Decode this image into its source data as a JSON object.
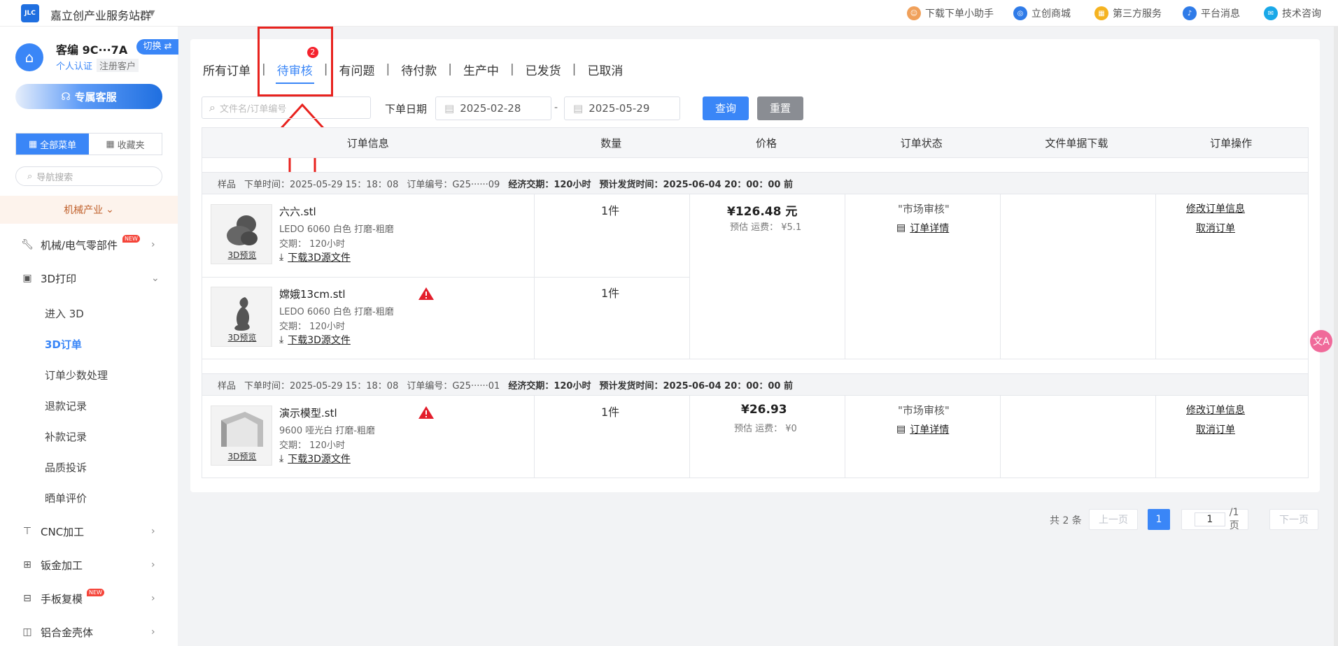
{
  "topbar": {
    "logo_text": "JLC",
    "site_title": "嘉立创产业服务站群",
    "links": [
      {
        "label": "下载下单小助手",
        "icon": "assistant-icon",
        "color": "#f0a05a"
      },
      {
        "label": "立创商城",
        "icon": "mall-icon",
        "color": "#2f7be8"
      },
      {
        "label": "第三方服务",
        "icon": "grid-icon",
        "color": "#f5b320"
      },
      {
        "label": "平台消息",
        "icon": "bell-icon",
        "color": "#2f7be8"
      },
      {
        "label": "技术咨询",
        "icon": "chat-icon",
        "color": "#19a8e8"
      }
    ]
  },
  "sidebar": {
    "customer_id": "客编 9C···7A",
    "switch_label": "切换 ⇄",
    "tag_verify": "个人认证",
    "tag_registered": "注册客户",
    "service_btn": "专属客服",
    "tab_all": "全部菜单",
    "tab_fav": "收藏夹",
    "search_placeholder": "导航搜索",
    "industry": "机械产业",
    "items": [
      {
        "label": "机械/电气零部件",
        "icon": "wrench-icon",
        "badge": "NEW"
      },
      {
        "label": "3D打印",
        "icon": "3d-print-icon"
      },
      {
        "label": "CNC加工",
        "icon": "cnc-icon"
      },
      {
        "label": "钣金加工",
        "icon": "sheet-metal-icon"
      },
      {
        "label": "手板复模",
        "icon": "mold-icon",
        "badge": "NEW"
      },
      {
        "label": "铝合金壳体",
        "icon": "enclosure-icon"
      }
    ],
    "sub_items": [
      "进入 3D",
      "3D订单",
      "订单少数处理",
      "退款记录",
      "补款记录",
      "品质投诉",
      "晒单评价"
    ]
  },
  "tabs": [
    {
      "label": "所有订单"
    },
    {
      "label": "待审核",
      "badge": "2"
    },
    {
      "label": "有问题"
    },
    {
      "label": "待付款"
    },
    {
      "label": "生产中"
    },
    {
      "label": "已发货"
    },
    {
      "label": "已取消"
    }
  ],
  "filter": {
    "search_placeholder": "文件名/订单编号",
    "date_label": "下单日期",
    "date_from": "2025-02-28",
    "date_to": "2025-05-29",
    "query_btn": "查询",
    "reset_btn": "重置"
  },
  "table_headers": [
    "订单信息",
    "数量",
    "价格",
    "订单状态",
    "文件单据下载",
    "订单操作"
  ],
  "orders": [
    {
      "type": "样品",
      "time_label": "下单时间：",
      "time": "2025-05-29 15：18：08",
      "no_label": "订单编号：",
      "no": "G25······09",
      "deliv_type": "经济交期：",
      "deliv_hours": "120小时",
      "ship_label": "预计发货时间：",
      "ship_time": "2025-06-04 20：00：00 前",
      "items": [
        {
          "name": "六六.stl",
          "spec": "LEDO 6060 白色 打磨-粗磨",
          "deliv": "交期：  120小时",
          "preview": "3D预览",
          "download": "下载3D源文件",
          "qty": "1件",
          "warning": false
        },
        {
          "name": "嫦娥13cm.stl",
          "spec": "LEDO 6060 白色 打磨-粗磨",
          "deliv": "交期：  120小时",
          "preview": "3D预览",
          "download": "下载3D源文件",
          "qty": "1件",
          "warning": true
        }
      ],
      "price": "¥126.48 元",
      "ship_fee": "预估 运费：  ¥5.1",
      "status": "\"市场审核\"",
      "detail": "订单详情",
      "op_modify": "修改订单信息",
      "op_cancel": "取消订单"
    },
    {
      "type": "样品",
      "time_label": "下单时间：",
      "time": "2025-05-29 15：18：08",
      "no_label": "订单编号：",
      "no": "G25······01",
      "deliv_type": "经济交期：",
      "deliv_hours": "120小时",
      "ship_label": "预计发货时间：",
      "ship_time": "2025-06-04 20：00：00 前",
      "items": [
        {
          "name": "演示模型.stl",
          "spec": "9600 哑光白 打磨-粗磨",
          "deliv": "交期：  120小时",
          "preview": "3D预览",
          "download": "下载3D源文件",
          "qty": "1件",
          "warning": true
        }
      ],
      "price": "¥26.93",
      "ship_fee": "预估 运费：  ¥0",
      "status": "\"市场审核\"",
      "detail": "订单详情",
      "op_modify": "修改订单信息",
      "op_cancel": "取消订单"
    }
  ],
  "pagination": {
    "total": "共 2 条",
    "prev": "上一页",
    "current": "1",
    "page_input": "1",
    "page_total": "/1页",
    "next": "下一页"
  },
  "translate_fab": "文A"
}
